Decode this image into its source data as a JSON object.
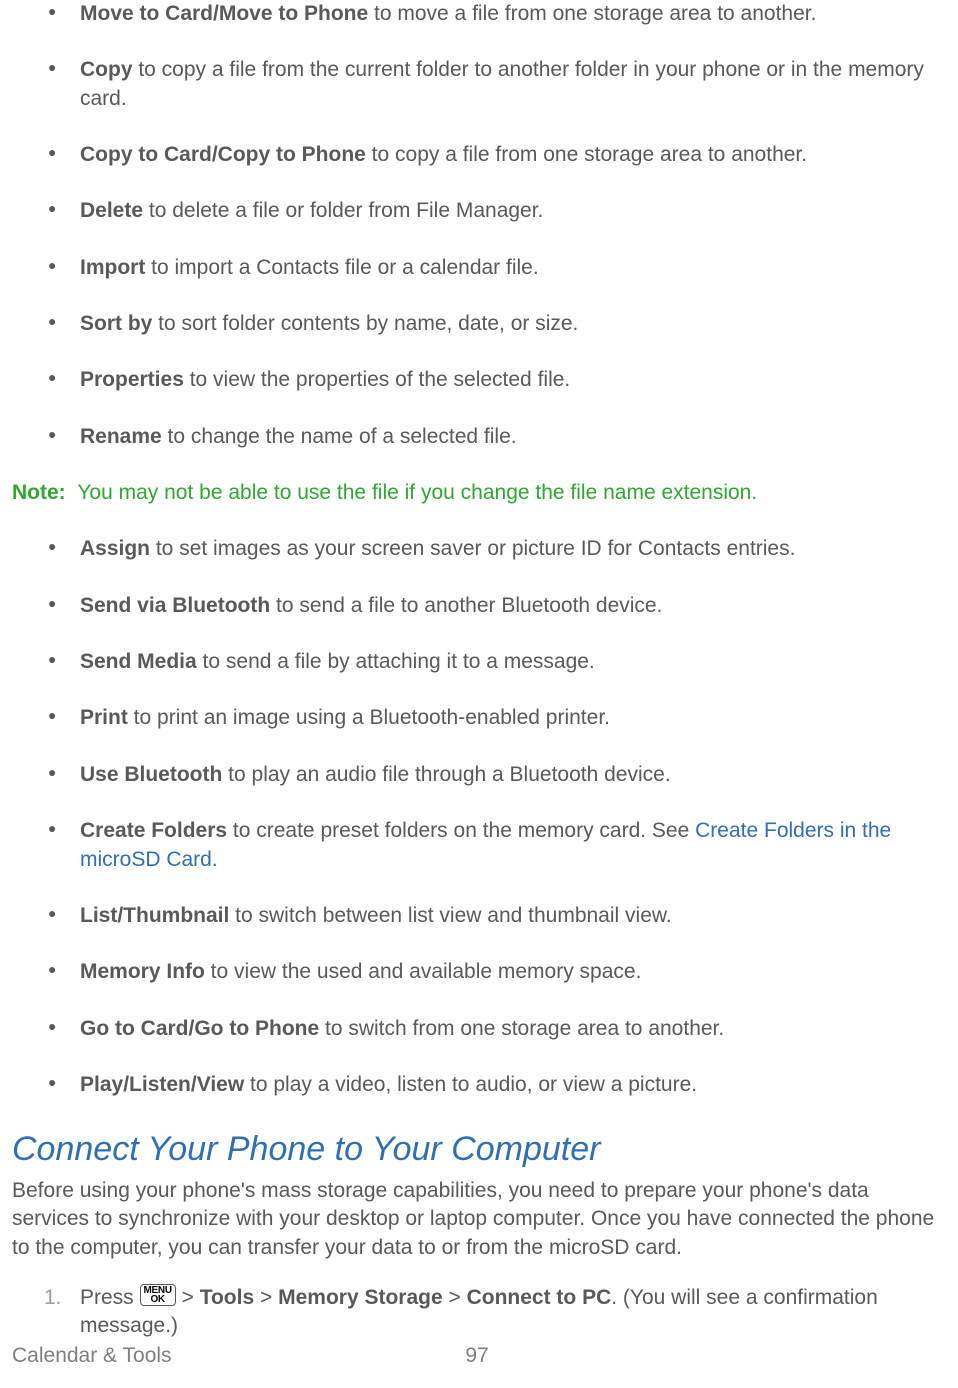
{
  "bullets1": [
    {
      "bold": "Move to Card/Move to Phone",
      "text": " to move a file from one storage area to another."
    },
    {
      "bold": "Copy",
      "text": " to copy a file from the current folder to another folder in your phone or in the memory card."
    },
    {
      "bold": "Copy to Card/Copy to Phone",
      "text": " to copy a file from one storage area to another."
    },
    {
      "bold": "Delete",
      "text": " to delete a file or folder from File Manager."
    },
    {
      "bold": "Import",
      "text": " to import a Contacts file or a calendar file."
    },
    {
      "bold": "Sort by",
      "text": " to sort folder contents by name, date, or size."
    },
    {
      "bold": "Properties",
      "text": " to view the properties of the selected file."
    },
    {
      "bold": "Rename",
      "text": " to change the name of a selected file."
    }
  ],
  "note": {
    "label": "Note:",
    "text": "You may not be able to use the file if you change the file name extension."
  },
  "bullets2": [
    {
      "bold": "Assign",
      "text": " to set images as your screen saver or picture ID for Contacts entries."
    },
    {
      "bold": "Send via Bluetooth",
      "text": " to send a file to another Bluetooth device."
    },
    {
      "bold": "Send Media",
      "text": " to send a file by attaching it to a message."
    },
    {
      "bold": "Print",
      "text": " to print an image using a Bluetooth-enabled printer."
    },
    {
      "bold": "Use Bluetooth",
      "text": " to play an audio file through a Bluetooth device."
    },
    {
      "bold": "Create Folders",
      "text_before": " to create preset folders on the memory card. See ",
      "link": "Create Folders in the microSD Card",
      "text_after": "."
    },
    {
      "bold": "List/Thumbnail",
      "text": " to switch between list view and thumbnail view."
    },
    {
      "bold": "Memory Info",
      "text": " to view the used and available memory space."
    },
    {
      "bold": "Go to Card/Go to Phone",
      "text": " to switch from one storage area to another."
    },
    {
      "bold": "Play/Listen/View",
      "text": " to play a video, listen to audio, or view a picture."
    }
  ],
  "section_heading": "Connect Your Phone to Your Computer",
  "intro": "Before using your phone's mass storage capabilities, you need to prepare your phone's data services to synchronize with your desktop or laptop computer. Once you have connected the phone to the computer, you can transfer your data to or from the microSD card.",
  "step1": {
    "num": "1.",
    "press": "Press ",
    "gt": " > ",
    "b1": "Tools",
    "b2": "Memory Storage",
    "b3": "Connect to PC",
    "tail": ". (You will see a confirmation message.)"
  },
  "footer": {
    "section": "Calendar & Tools",
    "page": "97"
  },
  "icon": {
    "top": "MENU",
    "bottom": "OK"
  }
}
